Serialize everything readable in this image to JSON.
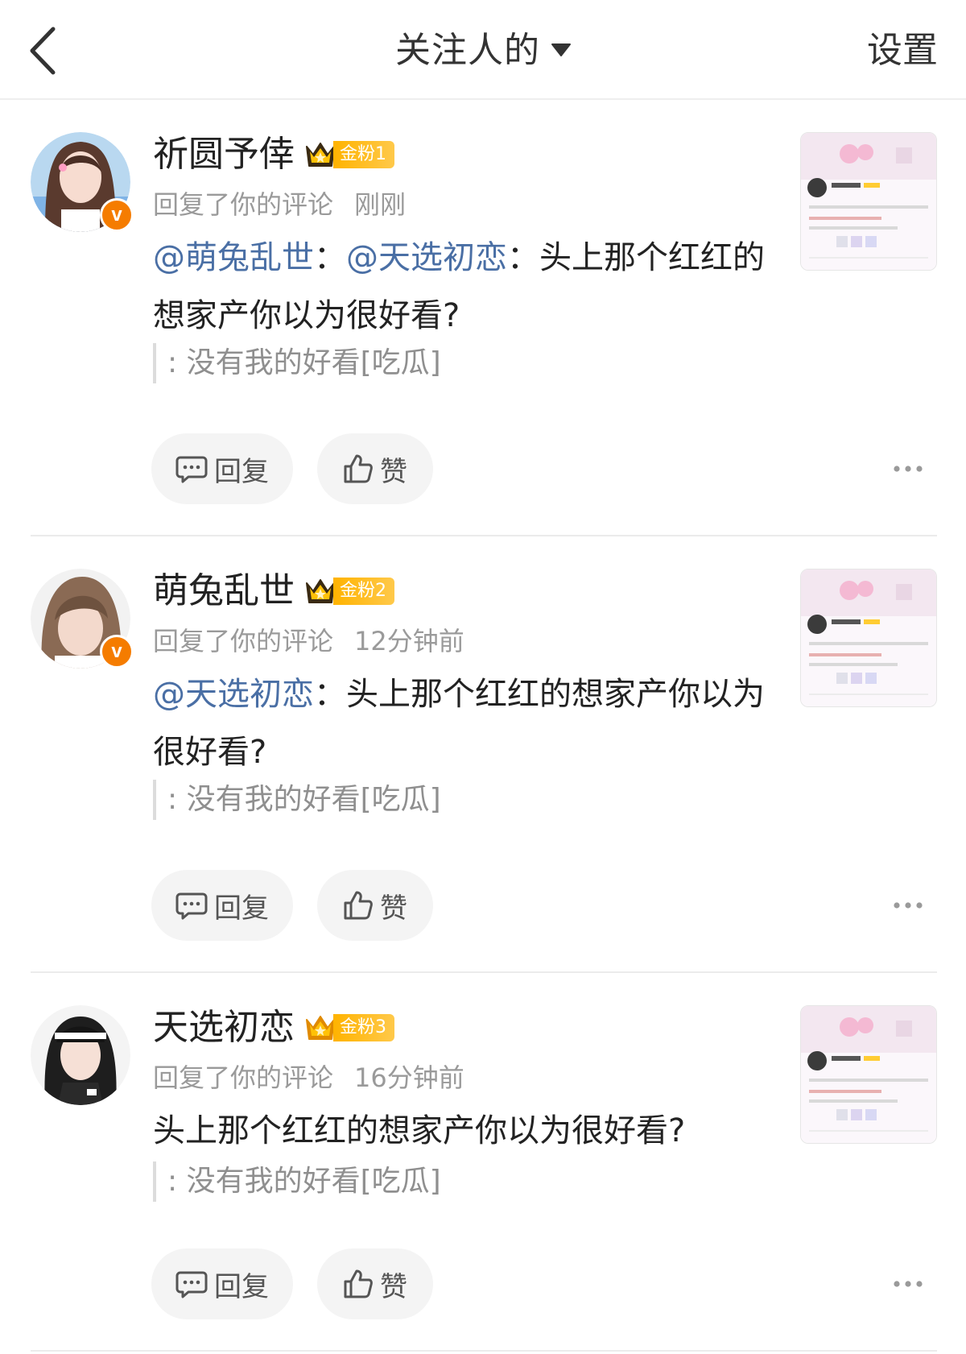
{
  "header": {
    "title": "关注人的",
    "settings_label": "设置"
  },
  "comments": [
    {
      "name": "祈圆予倖",
      "fan_badge": "金粉1",
      "action": "回复了你的评论",
      "time": "刚刚",
      "mention1": "@萌兔乱世",
      "mention2": "@天选初恋",
      "body": "头上那个红红的想家产你以为很好看?",
      "quote": ": 没有我的好看[吃瓜]",
      "reply_label": "回复",
      "like_label": "赞"
    },
    {
      "name": "萌兔乱世",
      "fan_badge": "金粉2",
      "action": "回复了你的评论",
      "time": "12分钟前",
      "mention1": "@天选初恋",
      "body": "头上那个红红的想家产你以为很好看?",
      "quote": ": 没有我的好看[吃瓜]",
      "reply_label": "回复",
      "like_label": "赞"
    },
    {
      "name": "天选初恋",
      "fan_badge": "金粉3",
      "action": "回复了你的评论",
      "time": "16分钟前",
      "body": "头上那个红红的想家产你以为很好看?",
      "quote": ": 没有我的好看[吃瓜]",
      "reply_label": "回复",
      "like_label": "赞"
    }
  ],
  "colors": {
    "mention": "#4a6fa5",
    "gold": "#ffb300",
    "verified": "#f57c00"
  },
  "icons": [
    "back-arrow-icon",
    "dropdown-caret-icon",
    "verified-v-icon",
    "crown-icon",
    "comment-icon",
    "thumbs-up-icon",
    "more-dots-icon"
  ]
}
